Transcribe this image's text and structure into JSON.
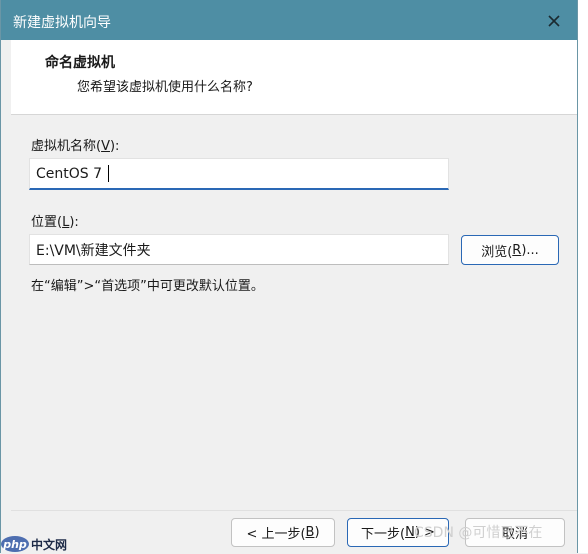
{
  "window": {
    "title": "新建虚拟机向导"
  },
  "header": {
    "title": "命名虚拟机",
    "subtitle": "您希望该虚拟机使用什么名称?"
  },
  "name_field": {
    "label_pre": "虚拟机名称(",
    "label_key": "V",
    "label_post": "):",
    "value": "CentOS 7"
  },
  "location_field": {
    "label_pre": "位置(",
    "label_key": "L",
    "label_post": "):",
    "value": "E:\\VM\\新建文件夹"
  },
  "browse_button": {
    "pre": "浏览(",
    "key": "R",
    "post": ")..."
  },
  "hint": "在“编辑”>“首选项”中可更改默认位置。",
  "footer": {
    "back": {
      "pre": "< 上一步(",
      "key": "B",
      "post": ")"
    },
    "next": {
      "pre": "下一步(",
      "key": "N",
      "post": ") >"
    },
    "cancel": "取消"
  },
  "watermarks": {
    "csdn": "CSDN @可惜已不在",
    "php_logo": "php 中文网"
  },
  "colors": {
    "titlebar": "#4e8ea4",
    "focus": "#2a68b5"
  }
}
